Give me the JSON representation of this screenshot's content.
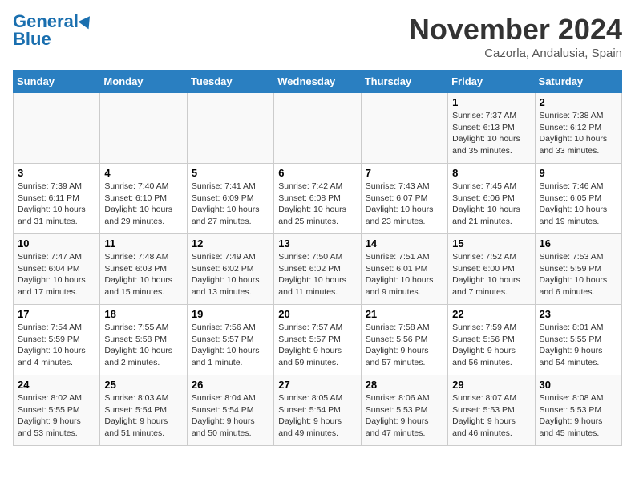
{
  "header": {
    "logo_line1": "General",
    "logo_line2": "Blue",
    "month": "November 2024",
    "location": "Cazorla, Andalusia, Spain"
  },
  "weekdays": [
    "Sunday",
    "Monday",
    "Tuesday",
    "Wednesday",
    "Thursday",
    "Friday",
    "Saturday"
  ],
  "weeks": [
    [
      {
        "day": "",
        "info": ""
      },
      {
        "day": "",
        "info": ""
      },
      {
        "day": "",
        "info": ""
      },
      {
        "day": "",
        "info": ""
      },
      {
        "day": "",
        "info": ""
      },
      {
        "day": "1",
        "info": "Sunrise: 7:37 AM\nSunset: 6:13 PM\nDaylight: 10 hours\nand 35 minutes."
      },
      {
        "day": "2",
        "info": "Sunrise: 7:38 AM\nSunset: 6:12 PM\nDaylight: 10 hours\nand 33 minutes."
      }
    ],
    [
      {
        "day": "3",
        "info": "Sunrise: 7:39 AM\nSunset: 6:11 PM\nDaylight: 10 hours\nand 31 minutes."
      },
      {
        "day": "4",
        "info": "Sunrise: 7:40 AM\nSunset: 6:10 PM\nDaylight: 10 hours\nand 29 minutes."
      },
      {
        "day": "5",
        "info": "Sunrise: 7:41 AM\nSunset: 6:09 PM\nDaylight: 10 hours\nand 27 minutes."
      },
      {
        "day": "6",
        "info": "Sunrise: 7:42 AM\nSunset: 6:08 PM\nDaylight: 10 hours\nand 25 minutes."
      },
      {
        "day": "7",
        "info": "Sunrise: 7:43 AM\nSunset: 6:07 PM\nDaylight: 10 hours\nand 23 minutes."
      },
      {
        "day": "8",
        "info": "Sunrise: 7:45 AM\nSunset: 6:06 PM\nDaylight: 10 hours\nand 21 minutes."
      },
      {
        "day": "9",
        "info": "Sunrise: 7:46 AM\nSunset: 6:05 PM\nDaylight: 10 hours\nand 19 minutes."
      }
    ],
    [
      {
        "day": "10",
        "info": "Sunrise: 7:47 AM\nSunset: 6:04 PM\nDaylight: 10 hours\nand 17 minutes."
      },
      {
        "day": "11",
        "info": "Sunrise: 7:48 AM\nSunset: 6:03 PM\nDaylight: 10 hours\nand 15 minutes."
      },
      {
        "day": "12",
        "info": "Sunrise: 7:49 AM\nSunset: 6:02 PM\nDaylight: 10 hours\nand 13 minutes."
      },
      {
        "day": "13",
        "info": "Sunrise: 7:50 AM\nSunset: 6:02 PM\nDaylight: 10 hours\nand 11 minutes."
      },
      {
        "day": "14",
        "info": "Sunrise: 7:51 AM\nSunset: 6:01 PM\nDaylight: 10 hours\nand 9 minutes."
      },
      {
        "day": "15",
        "info": "Sunrise: 7:52 AM\nSunset: 6:00 PM\nDaylight: 10 hours\nand 7 minutes."
      },
      {
        "day": "16",
        "info": "Sunrise: 7:53 AM\nSunset: 5:59 PM\nDaylight: 10 hours\nand 6 minutes."
      }
    ],
    [
      {
        "day": "17",
        "info": "Sunrise: 7:54 AM\nSunset: 5:59 PM\nDaylight: 10 hours\nand 4 minutes."
      },
      {
        "day": "18",
        "info": "Sunrise: 7:55 AM\nSunset: 5:58 PM\nDaylight: 10 hours\nand 2 minutes."
      },
      {
        "day": "19",
        "info": "Sunrise: 7:56 AM\nSunset: 5:57 PM\nDaylight: 10 hours\nand 1 minute."
      },
      {
        "day": "20",
        "info": "Sunrise: 7:57 AM\nSunset: 5:57 PM\nDaylight: 9 hours\nand 59 minutes."
      },
      {
        "day": "21",
        "info": "Sunrise: 7:58 AM\nSunset: 5:56 PM\nDaylight: 9 hours\nand 57 minutes."
      },
      {
        "day": "22",
        "info": "Sunrise: 7:59 AM\nSunset: 5:56 PM\nDaylight: 9 hours\nand 56 minutes."
      },
      {
        "day": "23",
        "info": "Sunrise: 8:01 AM\nSunset: 5:55 PM\nDaylight: 9 hours\nand 54 minutes."
      }
    ],
    [
      {
        "day": "24",
        "info": "Sunrise: 8:02 AM\nSunset: 5:55 PM\nDaylight: 9 hours\nand 53 minutes."
      },
      {
        "day": "25",
        "info": "Sunrise: 8:03 AM\nSunset: 5:54 PM\nDaylight: 9 hours\nand 51 minutes."
      },
      {
        "day": "26",
        "info": "Sunrise: 8:04 AM\nSunset: 5:54 PM\nDaylight: 9 hours\nand 50 minutes."
      },
      {
        "day": "27",
        "info": "Sunrise: 8:05 AM\nSunset: 5:54 PM\nDaylight: 9 hours\nand 49 minutes."
      },
      {
        "day": "28",
        "info": "Sunrise: 8:06 AM\nSunset: 5:53 PM\nDaylight: 9 hours\nand 47 minutes."
      },
      {
        "day": "29",
        "info": "Sunrise: 8:07 AM\nSunset: 5:53 PM\nDaylight: 9 hours\nand 46 minutes."
      },
      {
        "day": "30",
        "info": "Sunrise: 8:08 AM\nSunset: 5:53 PM\nDaylight: 9 hours\nand 45 minutes."
      }
    ]
  ]
}
